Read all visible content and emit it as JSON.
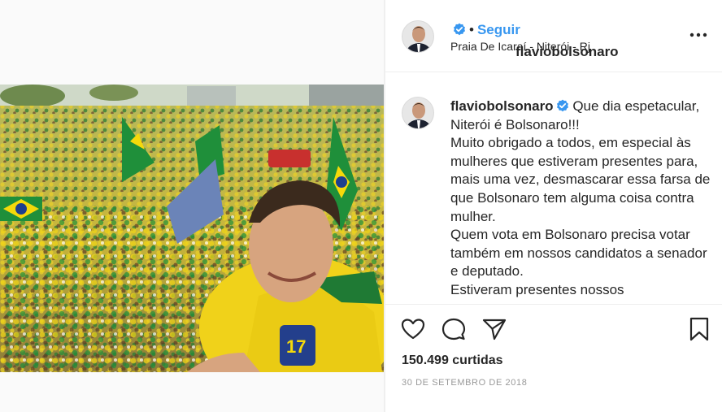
{
  "post": {
    "username": "flaviobolsonaro",
    "follow_label": "Seguir",
    "dot": "•",
    "location": "Praia De Icaraí - Niterói - Rj",
    "caption": "Que dia espetacular, Niterói é Bolsonaro!!!\nMuito obrigado a todos, em especial às mulheres que estiveram presentes para, mais uma vez, desmascarar essa farsa de que Bolsonaro tem alguma coisa contra mulher.\nQuem vota em Bolsonaro precisa votar também em nossos candidatos a senador e deputado.\nEstiveram presentes nossos",
    "likes": "150.499 curtidas",
    "date": "30 DE SETEMBRO DE 2018"
  },
  "icons": {
    "verified": "verified-badge-icon",
    "more": "more-options-icon",
    "like": "heart-icon",
    "comment": "comment-bubble-icon",
    "share": "paper-plane-icon",
    "save": "bookmark-icon"
  },
  "colors": {
    "link": "#3897f0",
    "text": "#262626",
    "muted": "#999999",
    "border": "#efefef",
    "brazil_green": "#1f8f3a",
    "brazil_yellow": "#f5d90a"
  }
}
